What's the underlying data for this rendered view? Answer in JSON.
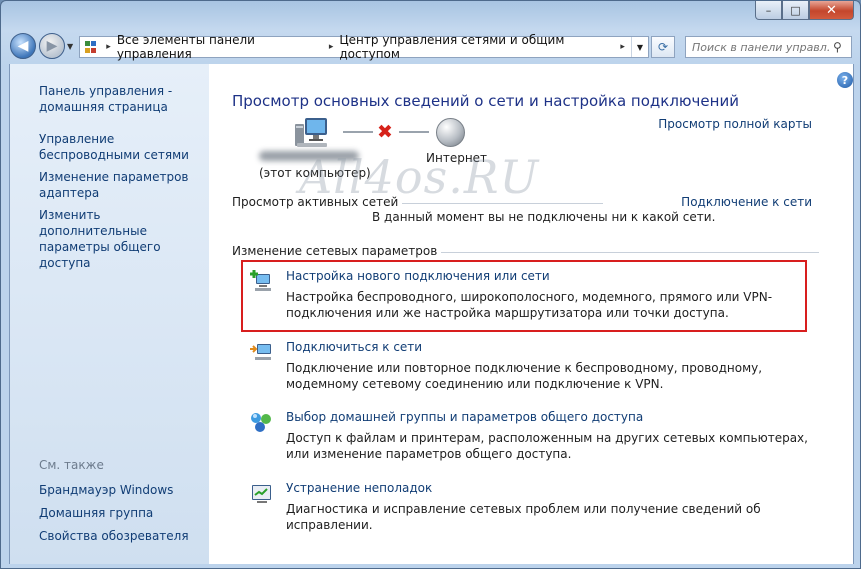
{
  "window": {
    "caption_min": "–",
    "caption_max": "□",
    "caption_close": "✕"
  },
  "address": {
    "segments": [
      "Все элементы панели управления",
      "Центр управления сетями и общим доступом"
    ],
    "separator": "▸",
    "search_placeholder": "Поиск в панели управл..."
  },
  "sidebar": {
    "items": [
      {
        "label": "Панель управления - домашняя страница"
      },
      {
        "label": "Управление беспроводными сетями"
      },
      {
        "label": "Изменение параметров адаптера"
      },
      {
        "label": "Изменить дополнительные параметры общего доступа"
      }
    ],
    "see_also_label": "См. также",
    "see_also": [
      {
        "label": "Брандмауэр Windows"
      },
      {
        "label": "Домашняя группа"
      },
      {
        "label": "Свойства обозревателя"
      }
    ]
  },
  "main": {
    "help": "?",
    "title": "Просмотр основных сведений о сети и настройка подключений",
    "full_map_link": "Просмотр полной карты",
    "map": {
      "computer_label": "(этот компьютер)",
      "internet_label": "Интернет"
    },
    "watermark": "All4os.RU",
    "active_networks_label": "Просмотр активных сетей",
    "connect_link": "Подключение к сети",
    "not_connected_text": "В данный момент вы не подключены ни к какой сети.",
    "change_settings_label": "Изменение сетевых параметров",
    "tasks": [
      {
        "icon": "new-connection-icon",
        "link": "Настройка нового подключения или сети",
        "desc": "Настройка беспроводного, широкополосного, модемного, прямого или VPN-подключения или же настройка маршрутизатора или точки доступа."
      },
      {
        "icon": "connect-network-icon",
        "link": "Подключиться к сети",
        "desc": "Подключение или повторное подключение к беспроводному, проводному, модемному сетевому соединению или подключение к VPN."
      },
      {
        "icon": "homegroup-icon",
        "link": "Выбор домашней группы и параметров общего доступа",
        "desc": "Доступ к файлам и принтерам, расположенным на других сетевых компьютерах, или изменение параметров общего доступа."
      },
      {
        "icon": "troubleshoot-icon",
        "link": "Устранение неполадок",
        "desc": "Диагностика и исправление сетевых проблем или получение сведений об исправлении."
      }
    ]
  }
}
